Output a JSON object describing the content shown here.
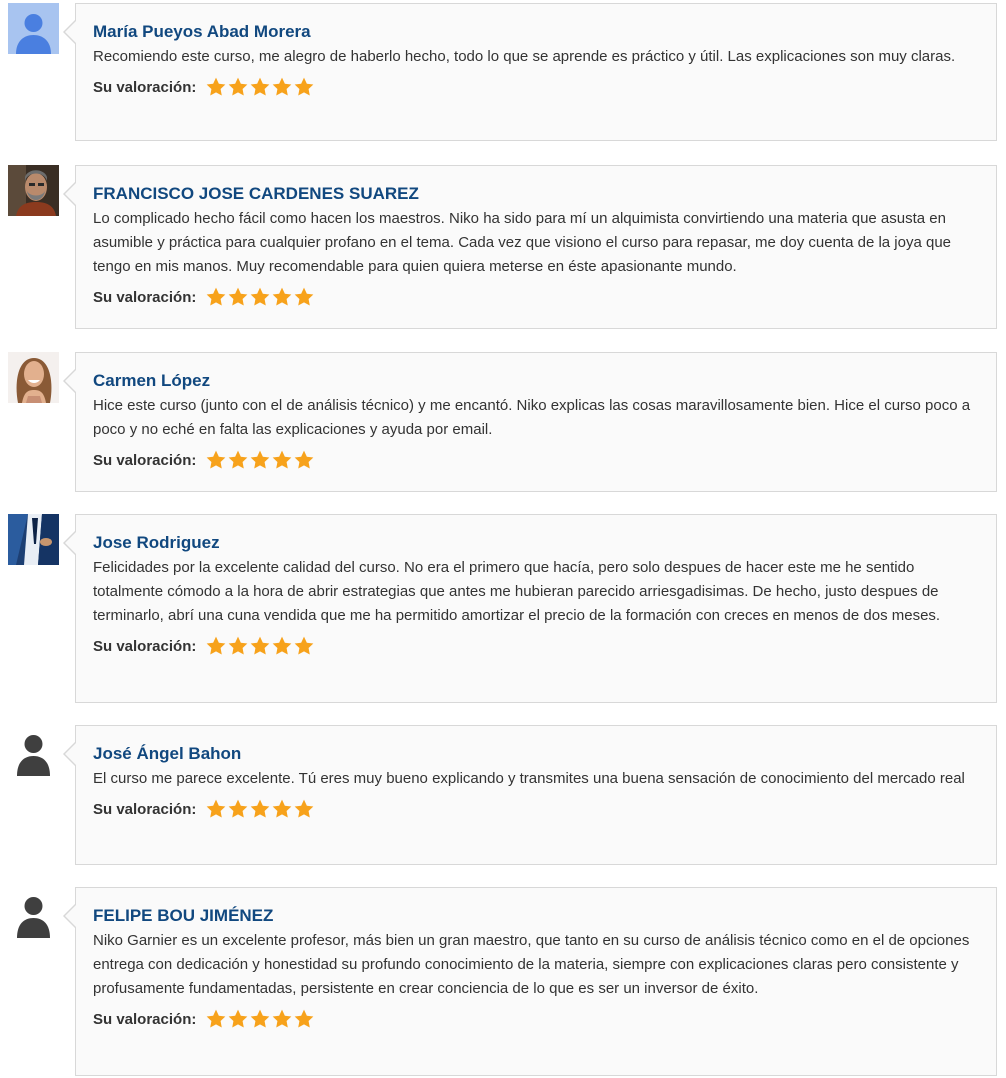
{
  "colors": {
    "name": "#11487f",
    "text": "#333333",
    "star": "#f7a21b",
    "bubble_bg": "#fafafa",
    "bubble_border": "#d8d8d8"
  },
  "rating_label": "Su valoración:",
  "reviews": [
    {
      "name": "María Pueyos Abad Morera",
      "avatar": "default-blue-avatar-icon",
      "stars": 5,
      "text": "Recomiendo este curso, me alegro de haberlo hecho, todo lo que se aprende es práctico y útil. Las explicaciones son muy claras."
    },
    {
      "name": "FRANCISCO JOSE CARDENES SUAREZ",
      "avatar": "photo-bearded-man",
      "stars": 5,
      "text": "Lo complicado hecho fácil como hacen los maestros. Niko ha sido para mí un alquimista convirtiendo una materia que asusta en asumible y práctica para cualquier profano en el tema. Cada vez que visiono el curso para repasar, me doy cuenta de la joya que tengo en mis manos. Muy recomendable para quien quiera meterse en éste apasionante mundo."
    },
    {
      "name": "Carmen López",
      "avatar": "photo-smiling-woman",
      "stars": 5,
      "text": "Hice este curso (junto con el de análisis técnico) y me encantó. Niko explicas las cosas maravillosamente bien. Hice el curso poco a poco y no eché en falta las explicaciones y ayuda por email."
    },
    {
      "name": "Jose Rodriguez",
      "avatar": "photo-man-in-suit",
      "stars": 5,
      "text": "Felicidades por la excelente calidad del curso. No era el primero que hacía, pero solo despues de hacer este me he sentido totalmente cómodo a la hora de abrir estrategias que antes me hubieran parecido arriesgadisimas. De hecho, justo despues de terminarlo, abrí una cuna vendida que me ha permitido amortizar el precio de la formación con creces en menos de dos meses."
    },
    {
      "name": "José Ángel Bahon",
      "avatar": "default-gray-person-icon",
      "stars": 5,
      "text": "El curso me parece excelente. Tú eres muy bueno explicando y transmites una buena sensación de conocimiento del mercado real"
    },
    {
      "name": "FELIPE BOU JIMÉNEZ",
      "avatar": "default-gray-person-icon",
      "stars": 5,
      "text": "Niko Garnier es un excelente profesor, más bien un gran maestro, que tanto en su curso de análisis técnico como en el de opciones entrega con dedicación y honestidad su profundo conocimiento de la materia, siempre con explicaciones claras pero consistente y profusamente fundamentadas, persistente en crear conciencia de lo que es ser un inversor de éxito."
    }
  ]
}
